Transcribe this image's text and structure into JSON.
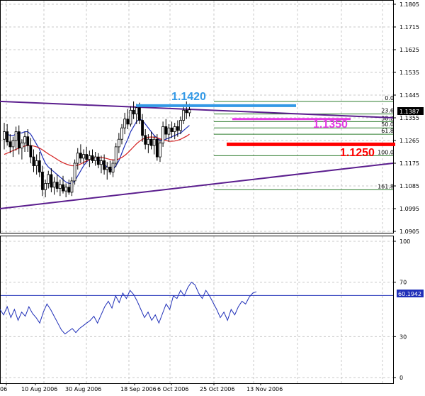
{
  "chart_data": [
    {
      "type": "candlestick",
      "title": "",
      "y_range": [
        1.0905,
        1.1805
      ],
      "y_ticks": [
        "1.1805",
        "1.1715",
        "1.1625",
        "1.1535",
        "1.1445",
        "1.1355",
        "1.1265",
        "1.1175",
        "1.1085",
        "1.0995",
        "1.0905"
      ],
      "current_price": "1.1387",
      "x_tick_labels": [
        "06",
        "10 Aug 2006",
        "30 Aug 2006",
        "18 Sep 2006",
        "6 Oct 2006",
        "25 Oct 2006",
        "13 Nov 2006"
      ],
      "grid": true,
      "series": [
        {
          "name": "",
          "kind": "candles",
          "color": "#000000",
          "candles": [
            {
              "o": 1.127,
              "h": 1.1335,
              "l": 1.123,
              "c": 1.13
            },
            {
              "o": 1.13,
              "h": 1.133,
              "l": 1.1245,
              "c": 1.126
            },
            {
              "o": 1.126,
              "h": 1.129,
              "l": 1.1215,
              "c": 1.124
            },
            {
              "o": 1.124,
              "h": 1.128,
              "l": 1.12,
              "c": 1.1265
            },
            {
              "o": 1.1265,
              "h": 1.132,
              "l": 1.1225,
              "c": 1.13
            },
            {
              "o": 1.13,
              "h": 1.1325,
              "l": 1.121,
              "c": 1.1235
            },
            {
              "o": 1.1235,
              "h": 1.127,
              "l": 1.119,
              "c": 1.1255
            },
            {
              "o": 1.1255,
              "h": 1.13,
              "l": 1.122,
              "c": 1.128
            },
            {
              "o": 1.128,
              "h": 1.131,
              "l": 1.122,
              "c": 1.1245
            },
            {
              "o": 1.1245,
              "h": 1.1275,
              "l": 1.1175,
              "c": 1.12
            },
            {
              "o": 1.12,
              "h": 1.123,
              "l": 1.114,
              "c": 1.1165
            },
            {
              "o": 1.1165,
              "h": 1.121,
              "l": 1.113,
              "c": 1.1185
            },
            {
              "o": 1.1185,
              "h": 1.122,
              "l": 1.112,
              "c": 1.114
            },
            {
              "o": 1.114,
              "h": 1.1165,
              "l": 1.1045,
              "c": 1.107
            },
            {
              "o": 1.107,
              "h": 1.111,
              "l": 1.104,
              "c": 1.1095
            },
            {
              "o": 1.1095,
              "h": 1.1145,
              "l": 1.1075,
              "c": 1.113
            },
            {
              "o": 1.113,
              "h": 1.1155,
              "l": 1.106,
              "c": 1.108
            },
            {
              "o": 1.108,
              "h": 1.112,
              "l": 1.105,
              "c": 1.11
            },
            {
              "o": 1.11,
              "h": 1.113,
              "l": 1.106,
              "c": 1.1075
            },
            {
              "o": 1.1075,
              "h": 1.111,
              "l": 1.1045,
              "c": 1.109
            },
            {
              "o": 1.109,
              "h": 1.1125,
              "l": 1.1055,
              "c": 1.1065
            },
            {
              "o": 1.1065,
              "h": 1.1095,
              "l": 1.104,
              "c": 1.108
            },
            {
              "o": 1.108,
              "h": 1.111,
              "l": 1.105,
              "c": 1.106
            },
            {
              "o": 1.106,
              "h": 1.112,
              "l": 1.1045,
              "c": 1.1105
            },
            {
              "o": 1.1105,
              "h": 1.119,
              "l": 1.109,
              "c": 1.1175
            },
            {
              "o": 1.1175,
              "h": 1.1235,
              "l": 1.115,
              "c": 1.1215
            },
            {
              "o": 1.1215,
              "h": 1.125,
              "l": 1.1175,
              "c": 1.1195
            },
            {
              "o": 1.1195,
              "h": 1.123,
              "l": 1.117,
              "c": 1.121
            },
            {
              "o": 1.121,
              "h": 1.124,
              "l": 1.118,
              "c": 1.119
            },
            {
              "o": 1.119,
              "h": 1.1225,
              "l": 1.116,
              "c": 1.1205
            },
            {
              "o": 1.1205,
              "h": 1.123,
              "l": 1.1175,
              "c": 1.1185
            },
            {
              "o": 1.1185,
              "h": 1.122,
              "l": 1.1165,
              "c": 1.12
            },
            {
              "o": 1.12,
              "h": 1.1215,
              "l": 1.1155,
              "c": 1.117
            },
            {
              "o": 1.117,
              "h": 1.1205,
              "l": 1.1135,
              "c": 1.1185
            },
            {
              "o": 1.1185,
              "h": 1.121,
              "l": 1.113,
              "c": 1.115
            },
            {
              "o": 1.115,
              "h": 1.118,
              "l": 1.111,
              "c": 1.116
            },
            {
              "o": 1.116,
              "h": 1.1185,
              "l": 1.113,
              "c": 1.114
            },
            {
              "o": 1.114,
              "h": 1.119,
              "l": 1.112,
              "c": 1.1175
            },
            {
              "o": 1.1175,
              "h": 1.1255,
              "l": 1.116,
              "c": 1.124
            },
            {
              "o": 1.124,
              "h": 1.1295,
              "l": 1.1215,
              "c": 1.127
            },
            {
              "o": 1.127,
              "h": 1.133,
              "l": 1.125,
              "c": 1.1315
            },
            {
              "o": 1.1315,
              "h": 1.1375,
              "l": 1.129,
              "c": 1.135
            },
            {
              "o": 1.135,
              "h": 1.139,
              "l": 1.131,
              "c": 1.133
            },
            {
              "o": 1.133,
              "h": 1.14,
              "l": 1.132,
              "c": 1.1385
            },
            {
              "o": 1.1385,
              "h": 1.142,
              "l": 1.135,
              "c": 1.137
            },
            {
              "o": 1.137,
              "h": 1.141,
              "l": 1.133,
              "c": 1.1395
            },
            {
              "o": 1.1395,
              "h": 1.1415,
              "l": 1.133,
              "c": 1.1345
            },
            {
              "o": 1.1345,
              "h": 1.137,
              "l": 1.126,
              "c": 1.1285
            },
            {
              "o": 1.1285,
              "h": 1.131,
              "l": 1.123,
              "c": 1.125
            },
            {
              "o": 1.125,
              "h": 1.129,
              "l": 1.1215,
              "c": 1.127
            },
            {
              "o": 1.127,
              "h": 1.13,
              "l": 1.123,
              "c": 1.1245
            },
            {
              "o": 1.1245,
              "h": 1.1285,
              "l": 1.121,
              "c": 1.127
            },
            {
              "o": 1.127,
              "h": 1.129,
              "l": 1.1185,
              "c": 1.12
            },
            {
              "o": 1.12,
              "h": 1.127,
              "l": 1.118,
              "c": 1.1255
            },
            {
              "o": 1.1255,
              "h": 1.134,
              "l": 1.124,
              "c": 1.132
            },
            {
              "o": 1.132,
              "h": 1.135,
              "l": 1.127,
              "c": 1.129
            },
            {
              "o": 1.129,
              "h": 1.133,
              "l": 1.126,
              "c": 1.1315
            },
            {
              "o": 1.1315,
              "h": 1.134,
              "l": 1.1275,
              "c": 1.13
            },
            {
              "o": 1.13,
              "h": 1.1335,
              "l": 1.127,
              "c": 1.132
            },
            {
              "o": 1.132,
              "h": 1.1345,
              "l": 1.128,
              "c": 1.1305
            },
            {
              "o": 1.1305,
              "h": 1.136,
              "l": 1.129,
              "c": 1.1345
            },
            {
              "o": 1.1345,
              "h": 1.14,
              "l": 1.133,
              "c": 1.1385
            },
            {
              "o": 1.1385,
              "h": 1.142,
              "l": 1.135,
              "c": 1.1375
            },
            {
              "o": 1.1375,
              "h": 1.141,
              "l": 1.136,
              "c": 1.1387
            }
          ]
        },
        {
          "name": "",
          "kind": "line",
          "color": "#1f2fb8",
          "values": [
            1.13,
            1.129,
            1.1285,
            1.1285,
            1.129,
            1.1295,
            1.1295,
            1.13,
            1.13,
            1.129,
            1.127,
            1.125,
            1.123,
            1.12,
            1.1175,
            1.116,
            1.115,
            1.114,
            1.113,
            1.112,
            1.111,
            1.11,
            1.1095,
            1.1095,
            1.1105,
            1.1125,
            1.1145,
            1.1165,
            1.118,
            1.119,
            1.1195,
            1.1195,
            1.119,
            1.118,
            1.117,
            1.116,
            1.115,
            1.115,
            1.1165,
            1.1185,
            1.1215,
            1.1245,
            1.127,
            1.13,
            1.132,
            1.134,
            1.135,
            1.1345,
            1.133,
            1.1315,
            1.13,
            1.1285,
            1.1275,
            1.1265,
            1.1265,
            1.127,
            1.1275,
            1.128,
            1.1285,
            1.129,
            1.1295,
            1.1305,
            1.1315,
            1.1325
          ]
        },
        {
          "name": "",
          "kind": "line",
          "color": "#d42020",
          "values": [
            1.121,
            1.1215,
            1.122,
            1.1225,
            1.123,
            1.1235,
            1.124,
            1.1243,
            1.1245,
            1.1245,
            1.1243,
            1.124,
            1.1235,
            1.1228,
            1.122,
            1.1212,
            1.1205,
            1.1198,
            1.119,
            1.1183,
            1.1177,
            1.1172,
            1.1168,
            1.1165,
            1.1165,
            1.1167,
            1.1172,
            1.1178,
            1.1184,
            1.119,
            1.1194,
            1.1197,
            1.1198,
            1.1198,
            1.1196,
            1.1193,
            1.119,
            1.1188,
            1.1188,
            1.1192,
            1.1198,
            1.1206,
            1.1216,
            1.1228,
            1.124,
            1.1252,
            1.1262,
            1.127,
            1.1275,
            1.1278,
            1.1279,
            1.1278,
            1.1276,
            1.1272,
            1.1268,
            1.1265,
            1.1262,
            1.1262,
            1.1263,
            1.1266,
            1.127,
            1.1276,
            1.1282,
            1.129
          ]
        }
      ],
      "trendlines": [
        {
          "name": "",
          "color": "#5b1e8e",
          "from": {
            "x": 0,
            "y": 1.142
          },
          "to": {
            "x": 87,
            "y": 1.1355
          }
        },
        {
          "name": "",
          "color": "#5b1e8e",
          "from": {
            "x": 0,
            "y": 1.0995
          },
          "to": {
            "x": 87,
            "y": 1.1175
          }
        }
      ],
      "horizontal_levels": [
        {
          "label": "1.1420",
          "value": 1.142,
          "color": "#3399e6"
        },
        {
          "label": "1.1350",
          "value": 1.135,
          "color": "#e639e6"
        },
        {
          "label": "1.1250",
          "value": 1.125,
          "color": "#ff0000"
        }
      ],
      "fibonacci": {
        "color": "#2e7d2e",
        "levels": [
          {
            "label": "0.0",
            "value": 1.142
          },
          {
            "label": "23.6",
            "value": 1.137
          },
          {
            "label": "38.2",
            "value": 1.134
          },
          {
            "label": "50.0",
            "value": 1.1315
          },
          {
            "label": "61.8",
            "value": 1.129
          },
          {
            "label": "100.0",
            "value": 1.1205
          },
          {
            "label": "161.8",
            "value": 1.107
          }
        ]
      }
    },
    {
      "type": "line",
      "title": "",
      "y_range": [
        0,
        100
      ],
      "y_ticks": [
        "100",
        "70",
        "30",
        "0"
      ],
      "current_value": "60.1942",
      "grid": true,
      "series": [
        {
          "name": "",
          "color": "#1f2fb8",
          "values": [
            50,
            46,
            52,
            44,
            50,
            42,
            48,
            45,
            52,
            47,
            44,
            40,
            48,
            54,
            50,
            45,
            40,
            35,
            32,
            34,
            36,
            33,
            36,
            38,
            40,
            42,
            45,
            40,
            46,
            52,
            56,
            51,
            60,
            55,
            62,
            58,
            64,
            61,
            56,
            50,
            44,
            48,
            42,
            46,
            40,
            47,
            54,
            50,
            60,
            58,
            64,
            60,
            66,
            70,
            68,
            62,
            58,
            64,
            60,
            55,
            50,
            44,
            48,
            42,
            50,
            46,
            52,
            56,
            54,
            59,
            62,
            63
          ]
        }
      ]
    }
  ]
}
